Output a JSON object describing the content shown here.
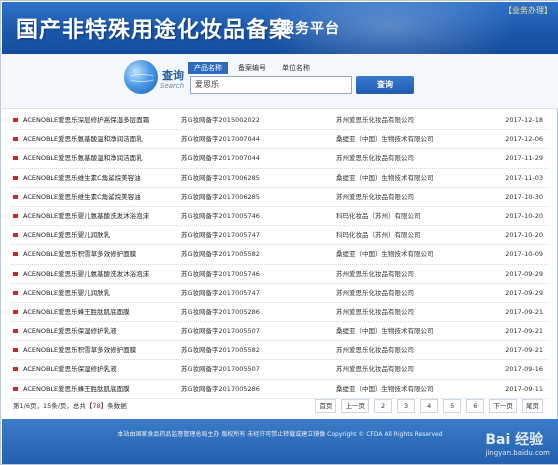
{
  "header": {
    "title": "国产非特殊用途化妆品备案",
    "subtitle": "服务平台",
    "badge": "【业务办理】"
  },
  "search": {
    "label": "查询",
    "label_en": "Search",
    "tabs": [
      "产品名称",
      "备案编号",
      "单位名称"
    ],
    "active_tab": "产品名称",
    "input_value": "爱思乐",
    "button_label": "查询"
  },
  "results": [
    {
      "name": "ACENOBLE爱思乐深层修护高保湿多层面霜",
      "reg": "苏G妆网备字2015002022",
      "company": "苏州爱思乐化妆品有限公司",
      "date": "2017-12-18"
    },
    {
      "name": "ACENOBLE爱思乐氨基酸温和净润洁面乳",
      "reg": "苏G妆网备字2017007044",
      "company": "桑缇亚（中国）生物技术有限公司",
      "date": "2017-12-06"
    },
    {
      "name": "ACENOBLE爱思乐氨基酸温和净润洁面乳",
      "reg": "苏G妆网备字2017007044",
      "company": "苏州爱思乐化妆品有限公司",
      "date": "2017-11-29"
    },
    {
      "name": "ACENOBLE爱思乐维生素C角鲨烷美容油",
      "reg": "苏G妆网备字2017006285",
      "company": "桑缇亚（中国）生物技术有限公司",
      "date": "2017-11-03"
    },
    {
      "name": "ACENOBLE爱思乐维生素C角鲨烷美容油",
      "reg": "苏G妆网备字2017006285",
      "company": "苏州爱思乐化妆品有限公司",
      "date": "2017-10-30"
    },
    {
      "name": "ACENOBLE爱思乐婴儿氨基酸洗发沐浴泡沫",
      "reg": "苏G妆网备字2017005746",
      "company": "科玛化妆品（苏州）有限公司",
      "date": "2017-10-20"
    },
    {
      "name": "ACENOBLE爱思乐婴儿润肤乳",
      "reg": "苏G妆网备字2017005747",
      "company": "科玛化妆品（苏州）有限公司",
      "date": "2017-10-20"
    },
    {
      "name": "ACENOBLE爱思乐积雪草多效修护面膜",
      "reg": "苏G妆网备字2017005582",
      "company": "桑缇亚（中国）生物技术有限公司",
      "date": "2017-10-09"
    },
    {
      "name": "ACENOBLE爱思乐婴儿氨基酸洗发沐浴泡沫",
      "reg": "苏G妆网备字2017005746",
      "company": "苏州爱思乐化妆品有限公司",
      "date": "2017-09-29"
    },
    {
      "name": "ACENOBLE爱思乐婴儿润肤乳",
      "reg": "苏G妆网备字2017005747",
      "company": "苏州爱思乐化妆品有限公司",
      "date": "2017-09-29"
    },
    {
      "name": "ACENOBLE爱思乐蜂王胜肽肌底面膜",
      "reg": "苏G妆网备字2017005286",
      "company": "苏州爱思乐化妆品有限公司",
      "date": "2017-09-21"
    },
    {
      "name": "ACENOBLE爱思乐保湿修护乳液",
      "reg": "苏G妆网备字2017005507",
      "company": "桑缇亚（中国）生物技术有限公司",
      "date": "2017-09-21"
    },
    {
      "name": "ACENOBLE爱思乐积雪草多效修护面膜",
      "reg": "苏G妆网备字2017005582",
      "company": "苏州爱思乐化妆品有限公司",
      "date": "2017-09-21"
    },
    {
      "name": "ACENOBLE爱思乐保湿修护乳液",
      "reg": "苏G妆网备字2017005507",
      "company": "苏州爱思乐化妆品有限公司",
      "date": "2017-09-16"
    },
    {
      "name": "ACENOBLE爱思乐蜂王胜肽肌底面膜",
      "reg": "苏G妆网备字2017005286",
      "company": "桑缇亚（中国）生物技术有限公司",
      "date": "2017-09-11"
    }
  ],
  "pager": {
    "info_prefix": "第1/6页，15条/页，总共【",
    "total": "78",
    "info_suffix": "】条数据",
    "first": "首页",
    "prev": "上一页",
    "pages": [
      "2",
      "3",
      "4",
      "5",
      "6"
    ],
    "next": "下一页",
    "last": "尾页"
  },
  "footer": {
    "copyright": "本站由国家食品药品监督管理总局主办 版权所有 未经许可禁止转载或建立镜像 Copyright © CFDA All Rights Reserved",
    "watermark": "Bai 经验",
    "watermark_sub": "jingyan.baidu.com"
  }
}
